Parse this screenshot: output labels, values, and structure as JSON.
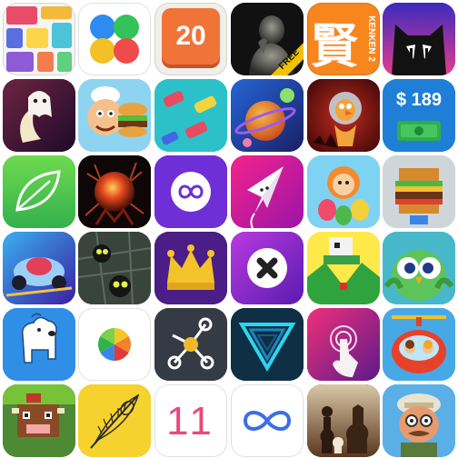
{
  "tiles": {
    "r1c3_number": "20",
    "r1c4_badge": "FREE",
    "r1c5_glyph": "賢",
    "r1c5_text": "KENKEN 2",
    "r2c6_price": "$ 189",
    "r6c3_number": "11"
  },
  "icon_names": [
    "mosaic-puzzle-icon",
    "four-circles-icon",
    "number-20-icon",
    "thinker-statue-icon",
    "kenken-icon",
    "cat-face-icon",
    "ghost-moon-icon",
    "chef-burger-icon",
    "traffic-cars-icon",
    "planets-icon",
    "bird-astronaut-icon",
    "money-189-icon",
    "leaf-icon",
    "red-sphere-icon",
    "infinity-purple-icon",
    "paper-plane-icon",
    "balloon-character-icon",
    "pixel-burger-icon",
    "racing-car-icon",
    "dark-eyes-icon",
    "crown-icon",
    "x-ball-icon",
    "pixel-bird-icon",
    "owl-icon",
    "white-dog-icon",
    "color-wheel-icon",
    "dots-path-icon",
    "neon-triangle-icon",
    "touch-hand-icon",
    "helicopter-kids-icon",
    "pixel-cow-icon",
    "peacock-feather-icon",
    "number-11-icon",
    "infinity-outline-icon",
    "chess-pieces-icon",
    "explorer-character-icon"
  ]
}
